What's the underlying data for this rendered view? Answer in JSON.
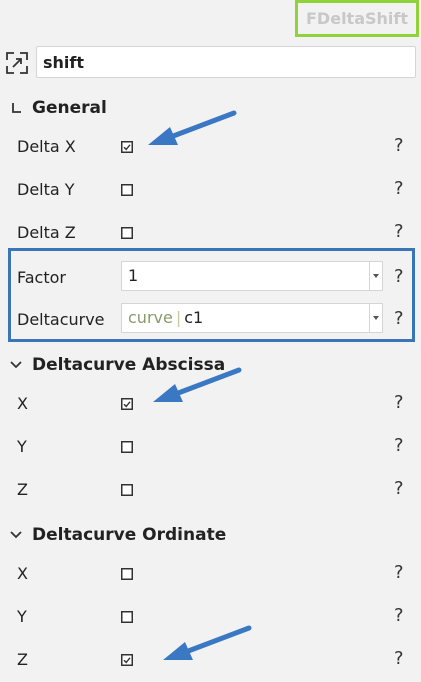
{
  "header": {
    "title": "FDeltaShift"
  },
  "search": {
    "value": "shift"
  },
  "sections": [
    {
      "title": "General",
      "rows": [
        {
          "label": "Delta X",
          "checked": true,
          "help": "?"
        },
        {
          "label": "Delta Y",
          "checked": false,
          "help": "?"
        },
        {
          "label": "Delta Z",
          "checked": false,
          "help": "?"
        }
      ],
      "fields": [
        {
          "label": "Factor",
          "value": "1",
          "help": "?"
        },
        {
          "label": "Deltacurve",
          "prefix": "curve",
          "separator": "|",
          "value": "c1",
          "help": "?"
        }
      ]
    },
    {
      "title": "Deltacurve Abscissa",
      "rows": [
        {
          "label": "X",
          "checked": true,
          "help": "?"
        },
        {
          "label": "Y",
          "checked": false,
          "help": "?"
        },
        {
          "label": "Z",
          "checked": false,
          "help": "?"
        }
      ]
    },
    {
      "title": "Deltacurve Ordinate",
      "rows": [
        {
          "label": "X",
          "checked": false,
          "help": "?"
        },
        {
          "label": "Y",
          "checked": false,
          "help": "?"
        },
        {
          "label": "Z",
          "checked": true,
          "help": "?"
        }
      ]
    }
  ],
  "colors": {
    "title_border": "#8fd23a",
    "highlight_box": "#3a75b8",
    "arrow": "#3a78c4",
    "curve_prefix": "#8a9a6a"
  },
  "icons": {
    "search": "expand-icon",
    "general_toggle": "collapse-corner-icon",
    "section_toggle": "chevron-down-icon",
    "field_dropdown": "dropdown-arrow-icon",
    "annotation": "arrow-annotation-icon"
  }
}
